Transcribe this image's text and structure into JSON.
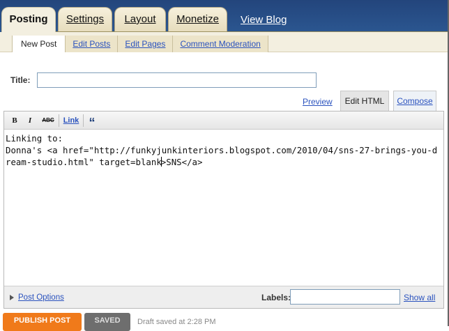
{
  "top_tabs": [
    "Posting",
    "Settings",
    "Layout",
    "Monetize"
  ],
  "view_blog": "View Blog",
  "subnav": [
    "New Post",
    "Edit Posts",
    "Edit Pages",
    "Comment Moderation"
  ],
  "title": {
    "label": "Title:",
    "value": ""
  },
  "mode": {
    "preview": "Preview",
    "edit_html": "Edit HTML",
    "compose": "Compose"
  },
  "toolbar": {
    "bold": "B",
    "italic": "I",
    "spell": "ABC",
    "link": "Link",
    "quote": "“"
  },
  "editor": {
    "line1": "Linking to:",
    "line2_before_caret": "Donna's <a href=\"http://funkyjunkinteriors.blogspot.com/2010/04/sns-27-brings-you-dream-studio.html\" target=blank",
    "line2_after_caret": ">SNS</a>"
  },
  "footer": {
    "post_options": "Post Options",
    "labels_label": "Labels:",
    "labels_value": "",
    "show_all": "Show all"
  },
  "bottom": {
    "publish": "PUBLISH POST",
    "saved": "SAVED",
    "draft_status": "Draft saved at 2:28 PM"
  },
  "colors": {
    "topbar": "#2b5690",
    "link": "#2a52be",
    "publish": "#f07a1a"
  }
}
